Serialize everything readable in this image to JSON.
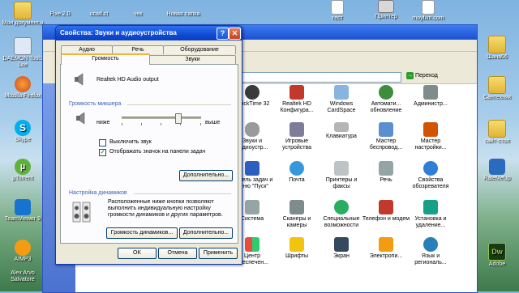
{
  "desktop": {
    "left_icons": [
      {
        "label": "Мои документы"
      },
      {
        "label": "DAEMON Tools Lite"
      },
      {
        "label": "Mozilla Firefox"
      },
      {
        "label": "Skype"
      },
      {
        "label": "µTorrent"
      },
      {
        "label": "TeamViewer 9"
      },
      {
        "label": "AIMP3"
      },
      {
        "label": "Alex Arvo Salvatore"
      }
    ],
    "top_icons": [
      {
        "label": "Pixe 2.0"
      },
      {
        "label": "ucad.ct"
      },
      {
        "label": "чек"
      },
      {
        "label": "Новая папка"
      },
      {
        "label": "тест"
      },
      {
        "label": "Принтер"
      },
      {
        "label": "moyfilm.com"
      }
    ],
    "right_icons": [
      {
        "label": "Шана06"
      },
      {
        "label": "Сантехник"
      },
      {
        "label": "сайт-стол"
      },
      {
        "label": "RateMeUp"
      },
      {
        "label": "Adobe"
      }
    ]
  },
  "explorer": {
    "go_label": "Переход",
    "items": [
      {
        "label": "QuickTime 32"
      },
      {
        "label": "Realtek HD Конфигура..."
      },
      {
        "label": "Windows CardSpace"
      },
      {
        "label": "Автомати... обновление"
      },
      {
        "label": "Администр..."
      },
      {
        "label": "Звуки и аудиоустр..."
      },
      {
        "label": "Игровые устройства"
      },
      {
        "label": "Клавиатура"
      },
      {
        "label": "Мастер беспровод..."
      },
      {
        "label": "Мастер настройки..."
      },
      {
        "label": "Панель задач и меню \"Пуск\""
      },
      {
        "label": "Почта"
      },
      {
        "label": "Принтеры и факсы"
      },
      {
        "label": "Речь"
      },
      {
        "label": "Свойства обозревателя"
      },
      {
        "label": "Система"
      },
      {
        "label": "Сканеры и камеры"
      },
      {
        "label": "Специальные возможности"
      },
      {
        "label": "Телефон и модем"
      },
      {
        "label": "Установка и удаление..."
      },
      {
        "label": "Центр обеспечен..."
      },
      {
        "label": "Шрифты"
      },
      {
        "label": "Экран"
      },
      {
        "label": "Электропи..."
      },
      {
        "label": "Язык и региональ..."
      }
    ]
  },
  "dialog": {
    "title": "Свойства: Звуки и аудиоустройства",
    "tabs_row1": [
      "Аудио",
      "Речь",
      "Оборудование"
    ],
    "tabs_row2": [
      "Громкость",
      "Звуки"
    ],
    "active_tab": "Громкость",
    "device_name": "Realtek HD Audio output",
    "mixer_group_title": "Громкость микшера",
    "slider_low": "ниже",
    "slider_high": "выше",
    "volume_level": 0.72,
    "mute_label": "Выключить звук",
    "mute_checked": false,
    "tray_label": "Отображать значок на панели задач",
    "tray_checked": true,
    "advanced_label": "Дополнительно...",
    "speakers_group_title": "Настройка динамиков",
    "speakers_desc": "Расположенные ниже кнопки позволяют выполнить индивидуальную настройку громкости динамиков и других параметров.",
    "speaker_volume_label": "Громкость динамиков...",
    "speaker_advanced_label": "Дополнительно...",
    "ok_label": "OK",
    "cancel_label": "Отмена",
    "apply_label": "Применить"
  }
}
